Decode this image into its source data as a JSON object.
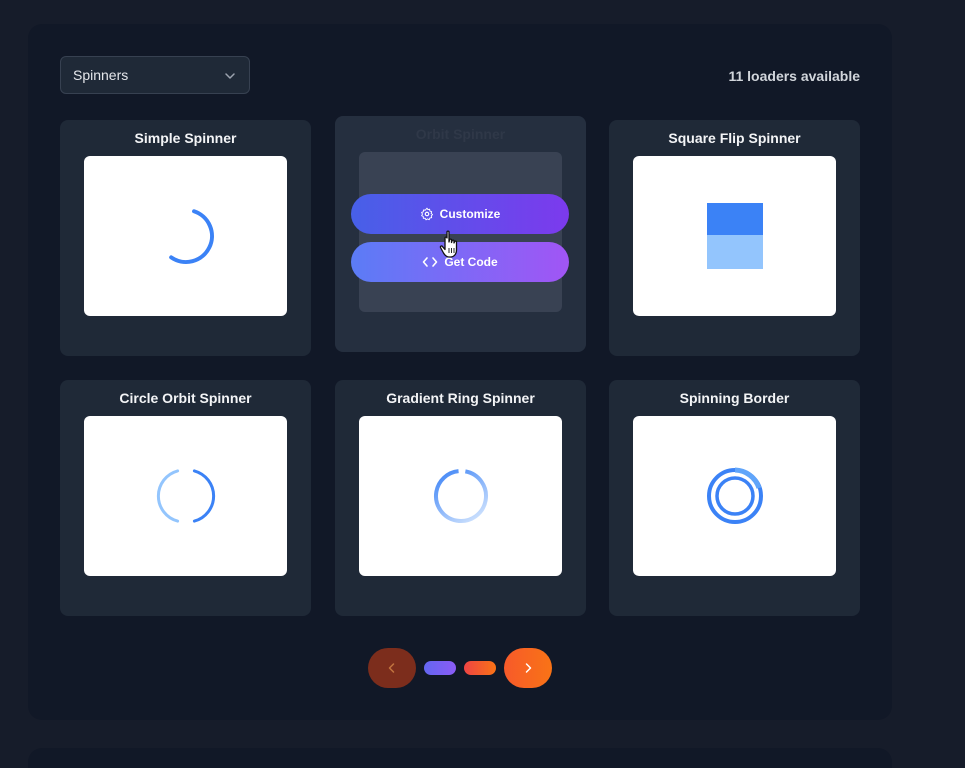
{
  "filter": {
    "selected": "Spinners",
    "icon": "chevron-down-icon"
  },
  "loader_count": "11 loaders available",
  "cards": [
    {
      "title": "Simple Spinner"
    },
    {
      "title": "Orbit Spinner"
    },
    {
      "title": "Square Flip Spinner"
    },
    {
      "title": "Circle Orbit Spinner"
    },
    {
      "title": "Gradient Ring Spinner"
    },
    {
      "title": "Spinning Border"
    }
  ],
  "hover_actions": {
    "customize_label": "Customize",
    "code_label": "Get Code"
  },
  "pagination": {
    "prev_icon": "chevron-left-icon",
    "next_icon": "chevron-right-icon",
    "pages": 2
  },
  "colors": {
    "spinner_blue": "#3b82f6",
    "spinner_light_blue": "#93c5fd",
    "accent_purple": "#7c3aed",
    "accent_orange": "#f97316"
  }
}
